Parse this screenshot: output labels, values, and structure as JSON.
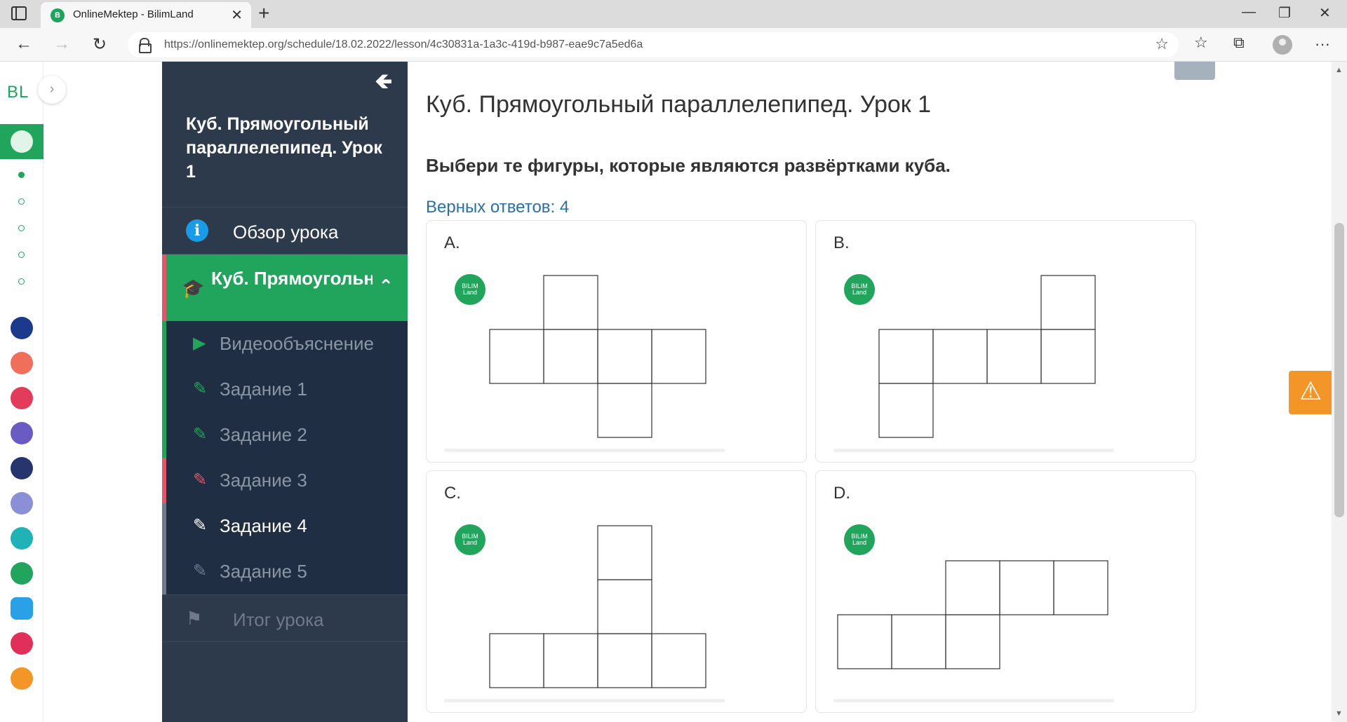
{
  "browser": {
    "tab_title": "OnlineMektep - BilimLand",
    "url": "https://onlinemektep.org/schedule/18.02.2022/lesson/4c30831a-1a3c-419d-b987-eae9c7a5ed6a",
    "new_tab": "+",
    "close": "✕",
    "back": "←",
    "forward": "→",
    "reload": "↻",
    "minimize": "—",
    "maximize": "❐",
    "window_close": "✕",
    "favorite": "☆",
    "favorites": "☆",
    "collections": "⧉",
    "more": "···"
  },
  "rail": {
    "logo": "BL",
    "expand": "›"
  },
  "lesson": {
    "title": "Куб. Прямоугольный параллелепипед. Урок 1",
    "back_arrow": "🡸",
    "overview": "Обзор урока",
    "overview_icon": "i",
    "section_label": "Куб. Прямоугольны...",
    "section_icon": "🎓",
    "section_chevron": "⌃",
    "items": [
      {
        "label": "Видеообъяснение",
        "icon": "▶",
        "color": "#21a55c",
        "edge": "#21a55c"
      },
      {
        "label": "Задание 1",
        "icon": "✎",
        "color": "#21a55c",
        "edge": "#21a55c"
      },
      {
        "label": "Задание 2",
        "icon": "✎",
        "color": "#21a55c",
        "edge": "#21a55c"
      },
      {
        "label": "Задание 3",
        "icon": "✎",
        "color": "#e0566a",
        "edge": "#e0566a"
      },
      {
        "label": "Задание 4",
        "icon": "✎",
        "color": "#ffffff",
        "edge": "#6f7b8a"
      },
      {
        "label": "Задание 5",
        "icon": "✎",
        "color": "#6f7b8a",
        "edge": "#6f7b8a"
      }
    ],
    "summary": "Итог урока",
    "summary_icon": "⚑"
  },
  "main": {
    "heading": "Куб. Прямоугольный параллелепипед. Урок 1",
    "question": "Выбери те фигуры, которые являются развёртками куба.",
    "correct_count": "Верных ответов: 4",
    "warning_icon": "⚠",
    "options": [
      {
        "letter": "A.",
        "badge": "BILIM Land"
      },
      {
        "letter": "B.",
        "badge": "BILIM Land"
      },
      {
        "letter": "C.",
        "badge": "BILIM Land"
      },
      {
        "letter": "D.",
        "badge": "BILIM Land"
      }
    ]
  },
  "colors": {
    "accent_green": "#21a55c",
    "sidebar_dark": "#2d3a4b",
    "sidebar_sub": "#1f2e42",
    "link_blue": "#2b6fa7",
    "warning_orange": "#f39627"
  }
}
